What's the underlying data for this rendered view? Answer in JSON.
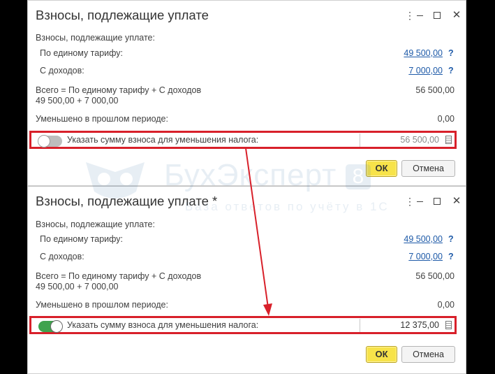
{
  "dialog1": {
    "title": "Взносы, подлежащие уплате",
    "section_label": "Взносы, подлежащие уплате:",
    "single_tariff_label": "По единому тарифу:",
    "single_tariff_value": "49 500,00",
    "income_label": "С доходов:",
    "income_value": "7 000,00",
    "help_mark": "?",
    "total_formula": "Всего = По единому тарифу + С доходов",
    "total_breakdown": "49 500,00 + 7 000,00",
    "total_value": "56 500,00",
    "reduced_label": "Уменьшено в прошлом периоде:",
    "reduced_value": "0,00",
    "toggle_state": "off",
    "toggle_label": "Указать сумму взноса для уменьшения налога:",
    "amount_value": "56 500,00",
    "ok_label": "ОК",
    "cancel_label": "Отмена"
  },
  "dialog2": {
    "title": "Взносы, подлежащие уплате *",
    "section_label": "Взносы, подлежащие уплате:",
    "single_tariff_label": "По единому тарифу:",
    "single_tariff_value": "49 500,00",
    "income_label": "С доходов:",
    "income_value": "7 000,00",
    "help_mark": "?",
    "total_formula": "Всего = По единому тарифу + С доходов",
    "total_breakdown": "49 500,00 + 7 000,00",
    "total_value": "56 500,00",
    "reduced_label": "Уменьшено в прошлом периоде:",
    "reduced_value": "0,00",
    "toggle_state": "on",
    "toggle_label": "Указать сумму взноса для уменьшения налога:",
    "amount_value": "12 375,00",
    "ok_label": "ОК",
    "cancel_label": "Отмена"
  },
  "window_icons": [
    "more-icon",
    "minimize-icon",
    "maximize-icon",
    "close-icon"
  ],
  "watermark": {
    "brand": "БухЭксперт",
    "badge": "8",
    "tagline": "База ответов по учёту в 1С"
  },
  "colors": {
    "highlight": "#d8202a",
    "arrow": "#d8202a",
    "link": "#1e5aa8",
    "ok_button": "#f7e34a",
    "toggle_on": "#3fa34d",
    "toggle_off": "#bdbdbd"
  }
}
